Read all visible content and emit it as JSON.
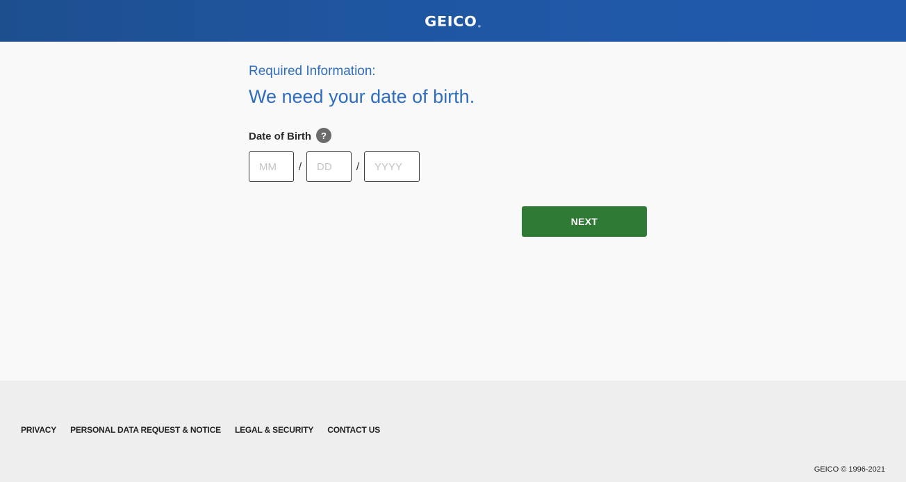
{
  "header": {
    "logo_text": "GEICO",
    "logo_mark": "®",
    "background_color": "#1f56a0"
  },
  "form": {
    "subtitle": "Required Information:",
    "title": "We need your date of birth.",
    "dob_label": "Date of Birth",
    "help_icon": "question-circle-icon",
    "help_glyph": "?",
    "month": {
      "value": "",
      "placeholder": "MM"
    },
    "day": {
      "value": "",
      "placeholder": "DD"
    },
    "year": {
      "value": "",
      "placeholder": "YYYY"
    },
    "separator": "/",
    "next_label": "NEXT",
    "accent_color": "#2f6dbf",
    "button_color": "#2f7a35"
  },
  "footer": {
    "links": [
      {
        "label": "PRIVACY"
      },
      {
        "label": "PERSONAL DATA REQUEST & NOTICE"
      },
      {
        "label": "LEGAL & SECURITY"
      },
      {
        "label": "CONTACT US"
      }
    ],
    "copyright": "GEICO © 1996-2021"
  }
}
